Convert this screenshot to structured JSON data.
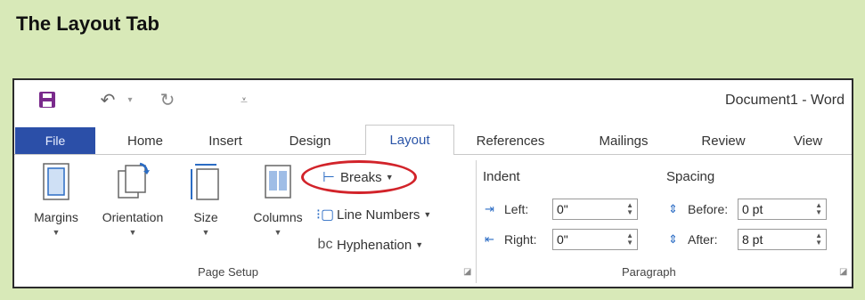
{
  "slide_title": "The Layout Tab",
  "titlebar": {
    "document_title": "Document1 - Word",
    "icons": [
      "save-icon",
      "undo-icon",
      "undo-dropdown-icon",
      "redo-icon",
      "customize-qat-icon"
    ]
  },
  "tabs": [
    {
      "label": "File"
    },
    {
      "label": "Home"
    },
    {
      "label": "Insert"
    },
    {
      "label": "Design"
    },
    {
      "label": "Layout",
      "active": true
    },
    {
      "label": "References"
    },
    {
      "label": "Mailings"
    },
    {
      "label": "Review"
    },
    {
      "label": "View"
    }
  ],
  "page_setup": {
    "margins": "Margins",
    "orientation": "Orientation",
    "size": "Size",
    "columns": "Columns",
    "breaks": "Breaks",
    "line_numbers": "Line Numbers",
    "hyphenation": "Hyphenation",
    "group_label": "Page Setup"
  },
  "paragraph": {
    "indent_heading": "Indent",
    "spacing_heading": "Spacing",
    "left_label": "Left:",
    "left_value": "0\"",
    "right_label": "Right:",
    "right_value": "0\"",
    "before_label": "Before:",
    "before_value": "0 pt",
    "after_label": "After:",
    "after_value": "8 pt",
    "group_label": "Paragraph"
  },
  "colors": {
    "background": "#d8e9b8",
    "file_tab": "#2b4fa8",
    "highlight": "#d2232a",
    "accent_icon": "#2b6cc4"
  }
}
